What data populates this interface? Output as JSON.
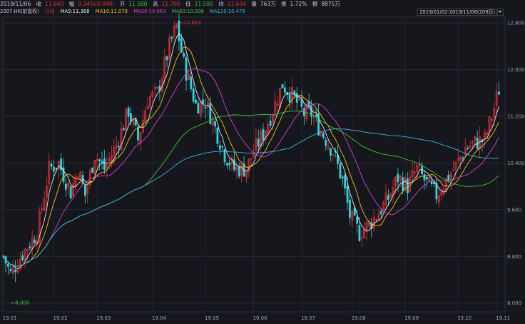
{
  "header": {
    "date": "2019/11/06",
    "close_label": "收",
    "close_value": "11.660",
    "change_label": "幅",
    "change_value": "0.34%(0.040)",
    "open_label": "开",
    "open_value": "11.500",
    "high_label": "高",
    "high_value": "11.700",
    "low_label": "低",
    "low_value": "11.500",
    "avg_label": "均",
    "avg_value": "11.634",
    "volume_label": "量",
    "volume_value": "763万",
    "amplitude_label": "振",
    "amplitude_value": "1.72%",
    "amount_label": "额",
    "amount_value": "8875万"
  },
  "legend": {
    "ticker": "2007.HK",
    "adjust": "(前复权)",
    "type": "日线",
    "ma5": "MA5:11.368",
    "ma10": "MA10:11.078",
    "ma20": "MA20:10.863",
    "ma60": "MA60:10.206",
    "ma120": "MA120:10.479"
  },
  "range_label": "2019/01/02-2019/11/06(209日)",
  "colors": {
    "background": "#16171c",
    "up": "#e0323a",
    "down": "#33d3dc",
    "ma5": "#e6e6e6",
    "ma10": "#f2c01e",
    "ma20": "#d63fd6",
    "ma60": "#3ec13e",
    "ma120": "#39b6e0"
  },
  "chart_data": {
    "type": "candlestick",
    "y_ticks": [
      "12.800",
      "12.000",
      "11.200",
      "10.400",
      "9.600",
      "8.800",
      "8.000"
    ],
    "y_tick_values": [
      12.8,
      12.0,
      11.2,
      10.4,
      9.6,
      8.8,
      8.0
    ],
    "x_ticks": [
      "19.01",
      "19.02",
      "19.03",
      "19.04",
      "19.05",
      "19.06",
      "19.07",
      "19.08",
      "19.09",
      "19.10",
      "19.11"
    ],
    "ylim": [
      7.85,
      12.9
    ],
    "annotations": {
      "high": "12.823",
      "low": "8.000"
    },
    "series": [
      {
        "name": "MA5",
        "color": "#e6e6e6"
      },
      {
        "name": "MA10",
        "color": "#f2c01e"
      },
      {
        "name": "MA20",
        "color": "#d63fd6"
      },
      {
        "name": "MA60",
        "color": "#3ec13e"
      },
      {
        "name": "MA120",
        "color": "#39b6e0"
      }
    ]
  }
}
